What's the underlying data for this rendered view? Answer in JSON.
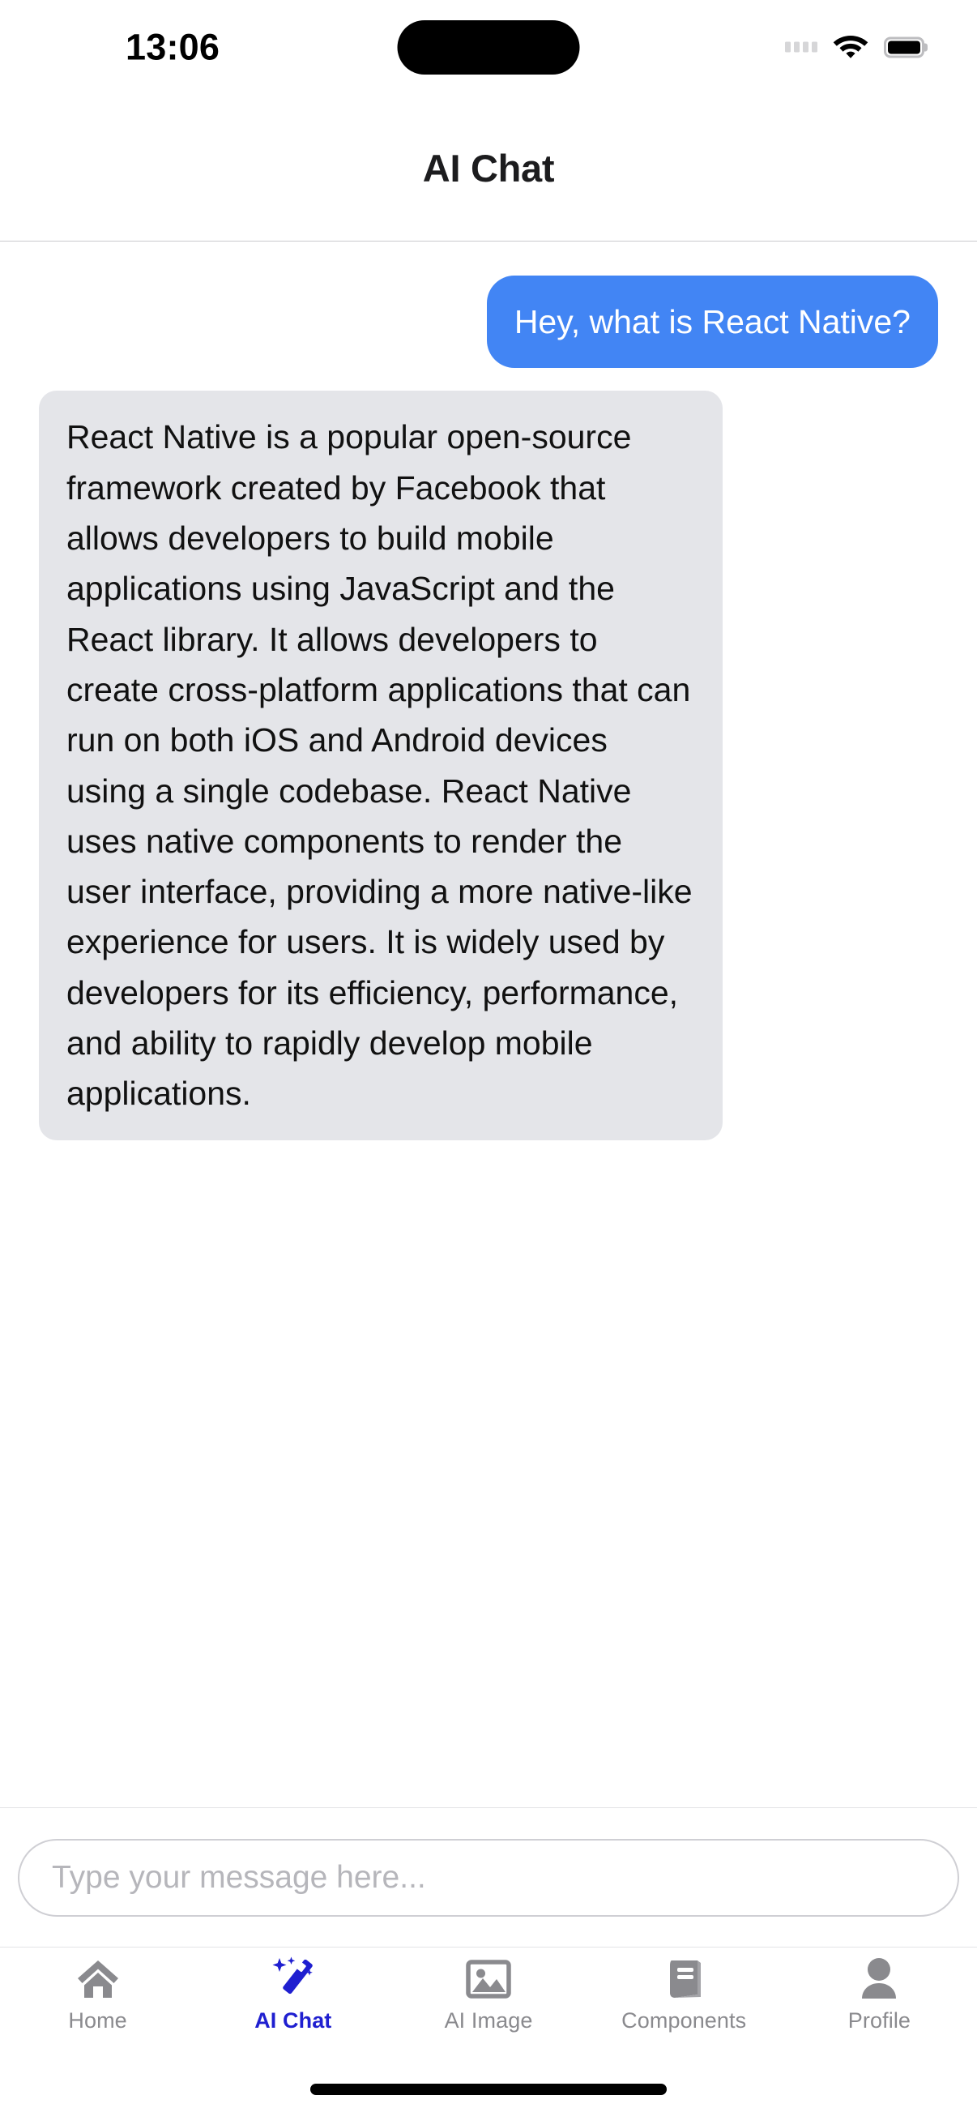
{
  "status_bar": {
    "time": "13:06",
    "cellular_icon": "cellular-signal-icon",
    "wifi_icon": "wifi-icon",
    "battery_icon": "battery-icon",
    "dynamic_island": "dynamic-island"
  },
  "header": {
    "title": "AI Chat"
  },
  "chat": {
    "messages": [
      {
        "sender": "user",
        "text": "Hey, what is React Native?"
      },
      {
        "sender": "bot",
        "text": "React Native is a popular open-source framework created by Facebook that allows developers to build mobile applications using JavaScript and the React library. It allows developers to create cross-platform applications that can run on both iOS and Android devices using a single codebase. React Native uses native components to render the user interface, providing a more native-like experience for users. It is widely used by developers for its efficiency, performance, and ability to rapidly develop mobile applications."
      }
    ]
  },
  "input": {
    "value": "",
    "placeholder": "Type your message here..."
  },
  "tab_bar": {
    "active_index": 1,
    "items": [
      {
        "label": "Home",
        "icon": "home-icon"
      },
      {
        "label": "AI Chat",
        "icon": "magic-wand-icon"
      },
      {
        "label": "AI Image",
        "icon": "image-icon"
      },
      {
        "label": "Components",
        "icon": "book-icon"
      },
      {
        "label": "Profile",
        "icon": "person-icon"
      }
    ]
  },
  "colors": {
    "user_bubble": "#4285F4",
    "bot_bubble": "#E4E5E9",
    "accent_active": "#1F1FD0",
    "tab_inactive": "#8A8A8E"
  }
}
